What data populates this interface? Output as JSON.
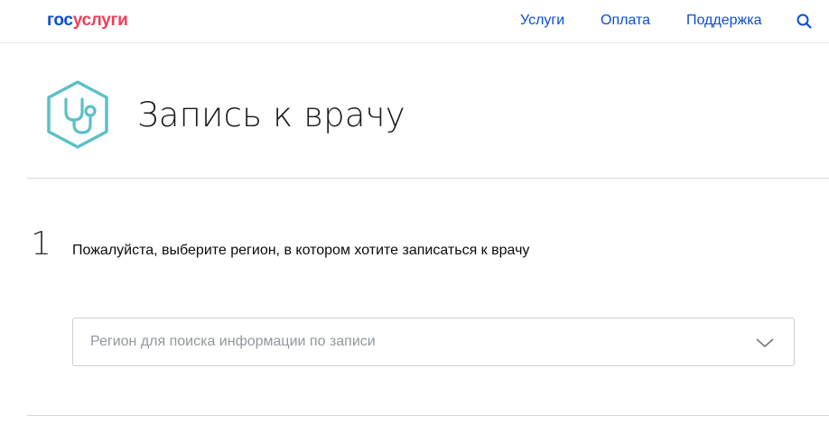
{
  "header": {
    "logo_part1": "гос",
    "logo_part2": "услуги",
    "nav": {
      "uslugi": "Услуги",
      "oplata": "Оплата",
      "podderzhka": "Поддержка"
    },
    "search_icon": "search-icon"
  },
  "main": {
    "service_icon": "stethoscope-icon",
    "title": "Запись к врачу",
    "step": {
      "number": "1",
      "text": "Пожалуйста, выберите регион, в котором хотите записаться к врачу"
    },
    "region_select": {
      "placeholder": "Регион для поиска информации по записи",
      "icon": "chevron-down-icon"
    }
  },
  "colors": {
    "brand_blue": "#0d4cd3",
    "brand_red": "#ee3f58",
    "icon_teal": "#5cc0c8",
    "divider": "#d4d8dd"
  }
}
